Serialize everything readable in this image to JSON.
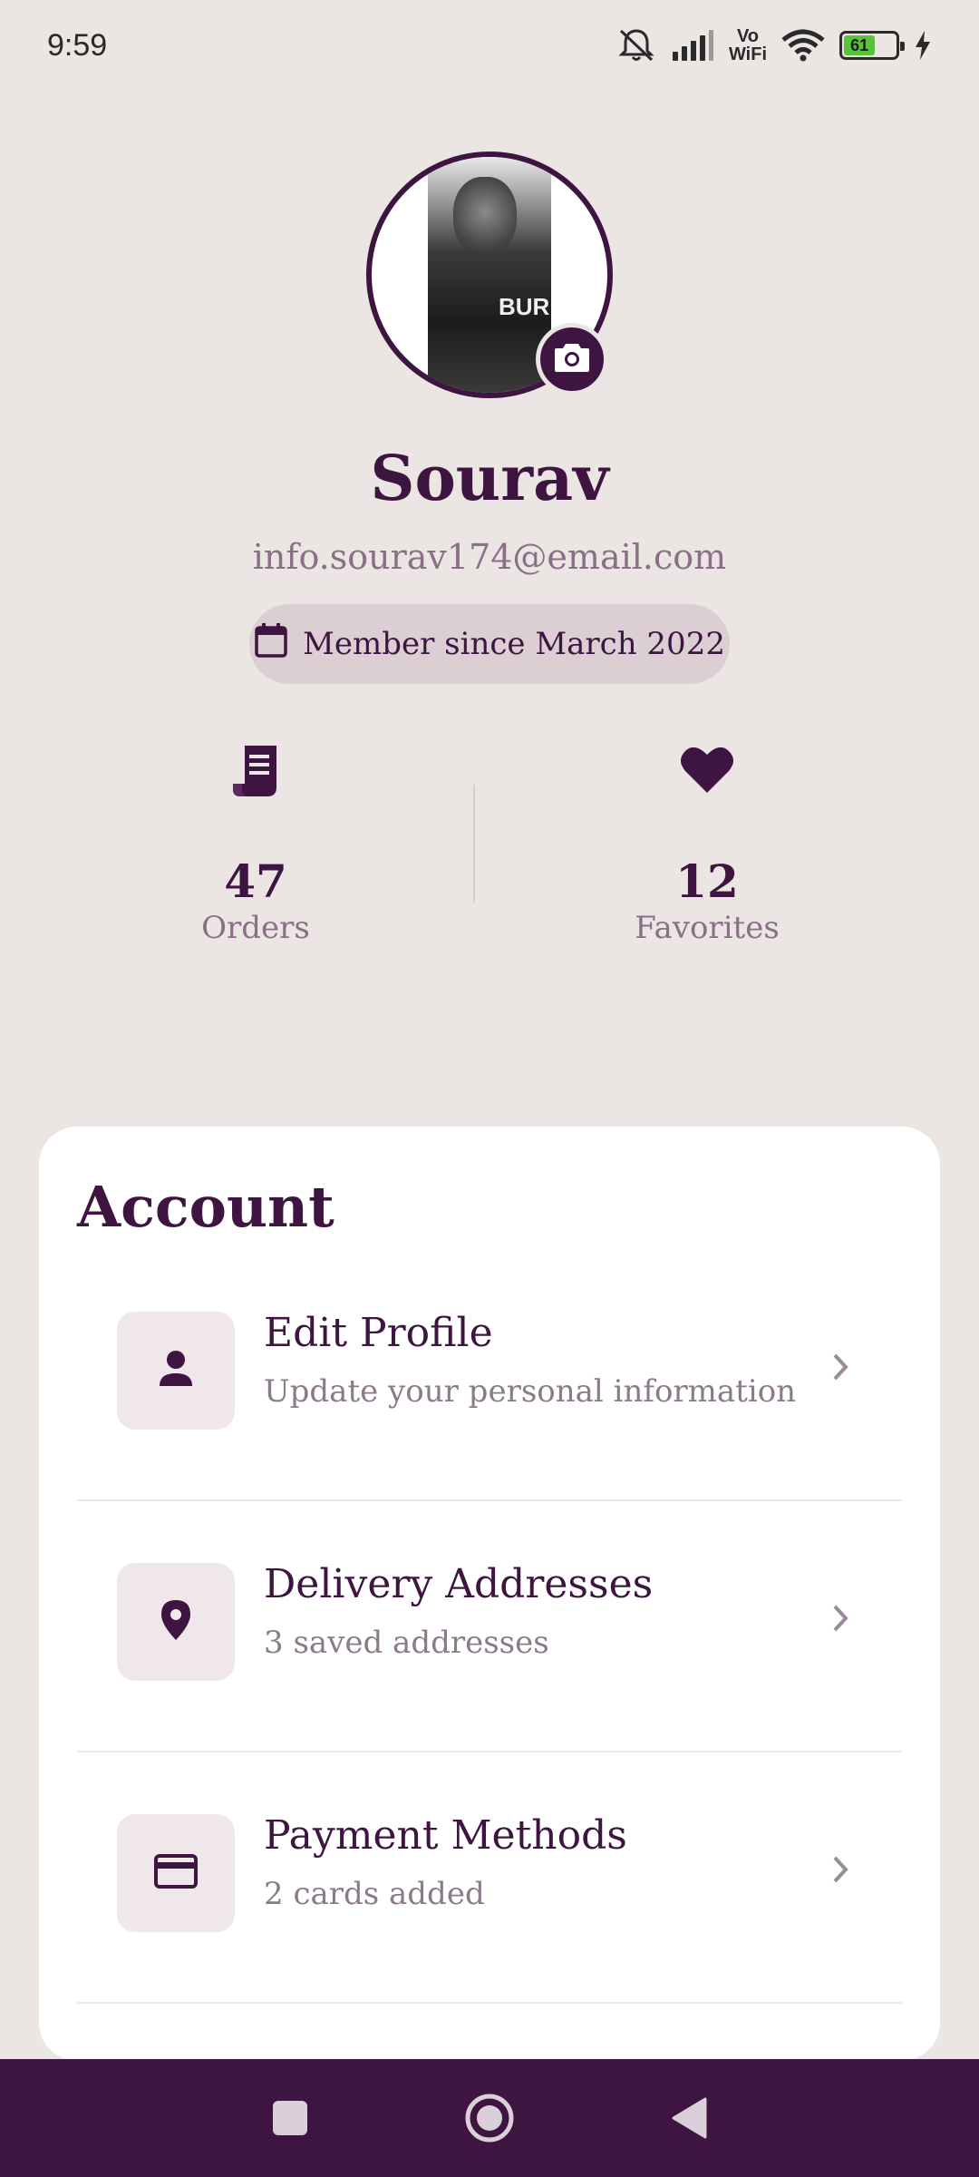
{
  "status_bar": {
    "time": "9:59",
    "vowifi_top": "Vo",
    "vowifi_bottom": "WiFi",
    "battery_level": "61",
    "battery_color": "#57c23a",
    "icons": [
      "mute-icon",
      "signal-icon",
      "vowifi-icon",
      "wifi-icon",
      "battery-icon",
      "charging-icon"
    ]
  },
  "profile": {
    "name": "Sourav",
    "email": "info.sourav174@email.com",
    "member_since": "Member since March 2022",
    "avatar_shirt_text": "BUR",
    "camera_icon": "camera-icon",
    "calendar_icon": "calendar-icon"
  },
  "stats": {
    "orders": {
      "value": "47",
      "label": "Orders",
      "icon": "receipt-icon"
    },
    "favorites": {
      "value": "12",
      "label": "Favorites",
      "icon": "heart-icon"
    }
  },
  "account": {
    "title": "Account",
    "items": [
      {
        "title": "Edit Profile",
        "subtitle": "Update your personal information",
        "icon": "person-icon"
      },
      {
        "title": "Delivery Addresses",
        "subtitle": "3 saved addresses",
        "icon": "location-pin-icon"
      },
      {
        "title": "Payment Methods",
        "subtitle": "2 cards added",
        "icon": "credit-card-icon"
      }
    ]
  },
  "nav": {
    "buttons": [
      "recents-square-icon",
      "home-circle-icon",
      "back-triangle-icon"
    ]
  },
  "colors": {
    "primary": "#3d1540",
    "background": "#ebe5e3",
    "muted_text": "#8a6f86",
    "pill_bg": "#dbcfd3",
    "icon_box_bg": "#efe7ea"
  }
}
